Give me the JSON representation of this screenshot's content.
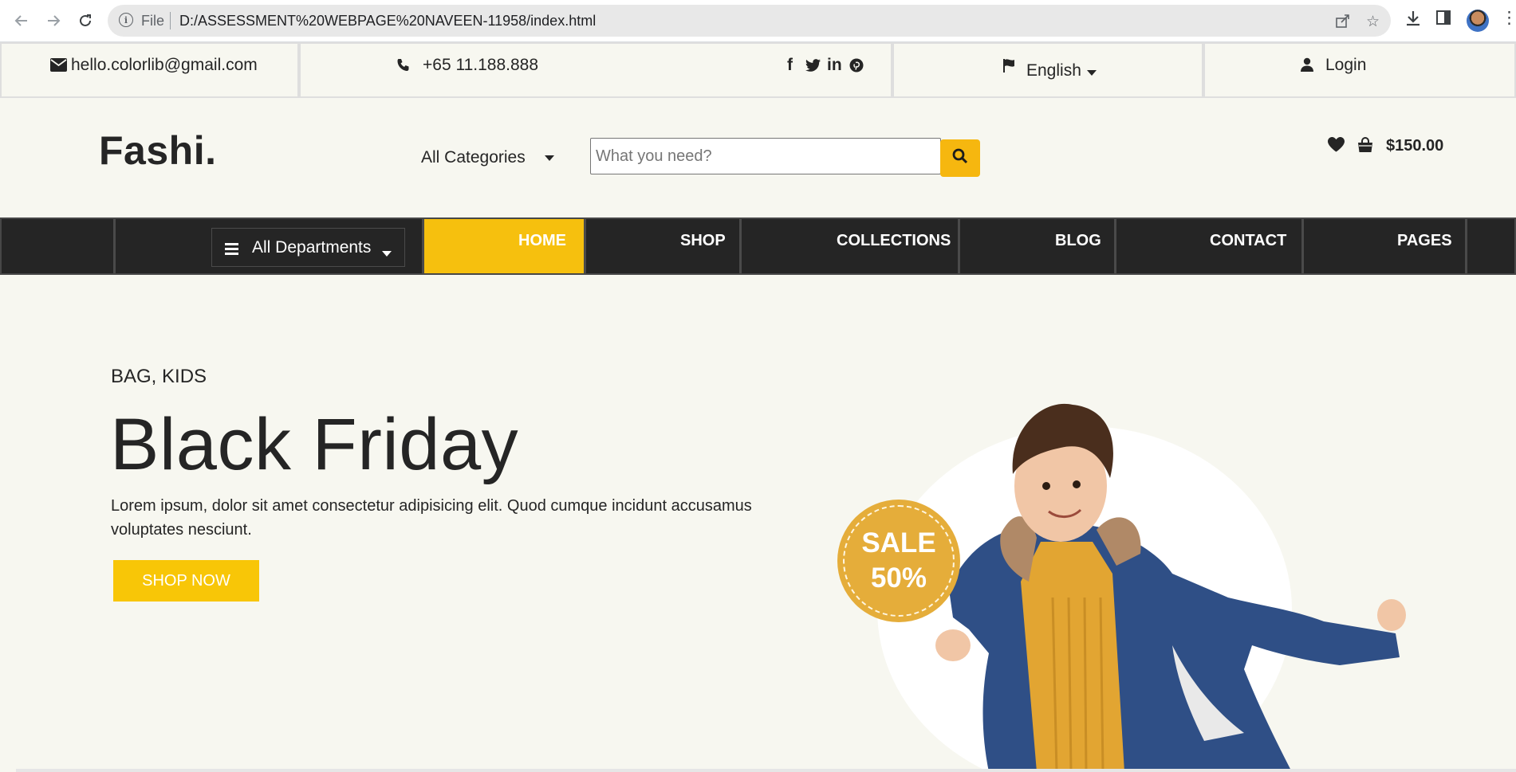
{
  "browser": {
    "file_label": "File",
    "url": "D:/ASSESSMENT%20WEBPAGE%20NAVEEN-11958/index.html"
  },
  "topbar": {
    "email": "hello.colorlib@gmail.com",
    "phone": "+65 11.188.888",
    "language": "English",
    "login": "Login",
    "social": [
      "facebook-icon",
      "twitter-icon",
      "linkedin-icon",
      "pinterest-icon"
    ]
  },
  "header": {
    "logo": "Fashi.",
    "category_select": "All Categories",
    "search_placeholder": "What you need?",
    "cart_total": "$150.00"
  },
  "nav": {
    "departments": "All Departments",
    "items": [
      "HOME",
      "SHOP",
      "COLLECTIONS",
      "BLOG",
      "CONTACT",
      "PAGES"
    ],
    "active": "HOME",
    "accent": "#f6c00e"
  },
  "hero": {
    "tags": "BAG, KIDS",
    "title": "Black Friday",
    "text": "Lorem ipsum, dolor sit amet consectetur adipisicing elit. Quod cumque incidunt accusamus voluptates nesciunt.",
    "button": "SHOP NOW",
    "sale_line1": "SALE",
    "sale_line2": "50%"
  }
}
